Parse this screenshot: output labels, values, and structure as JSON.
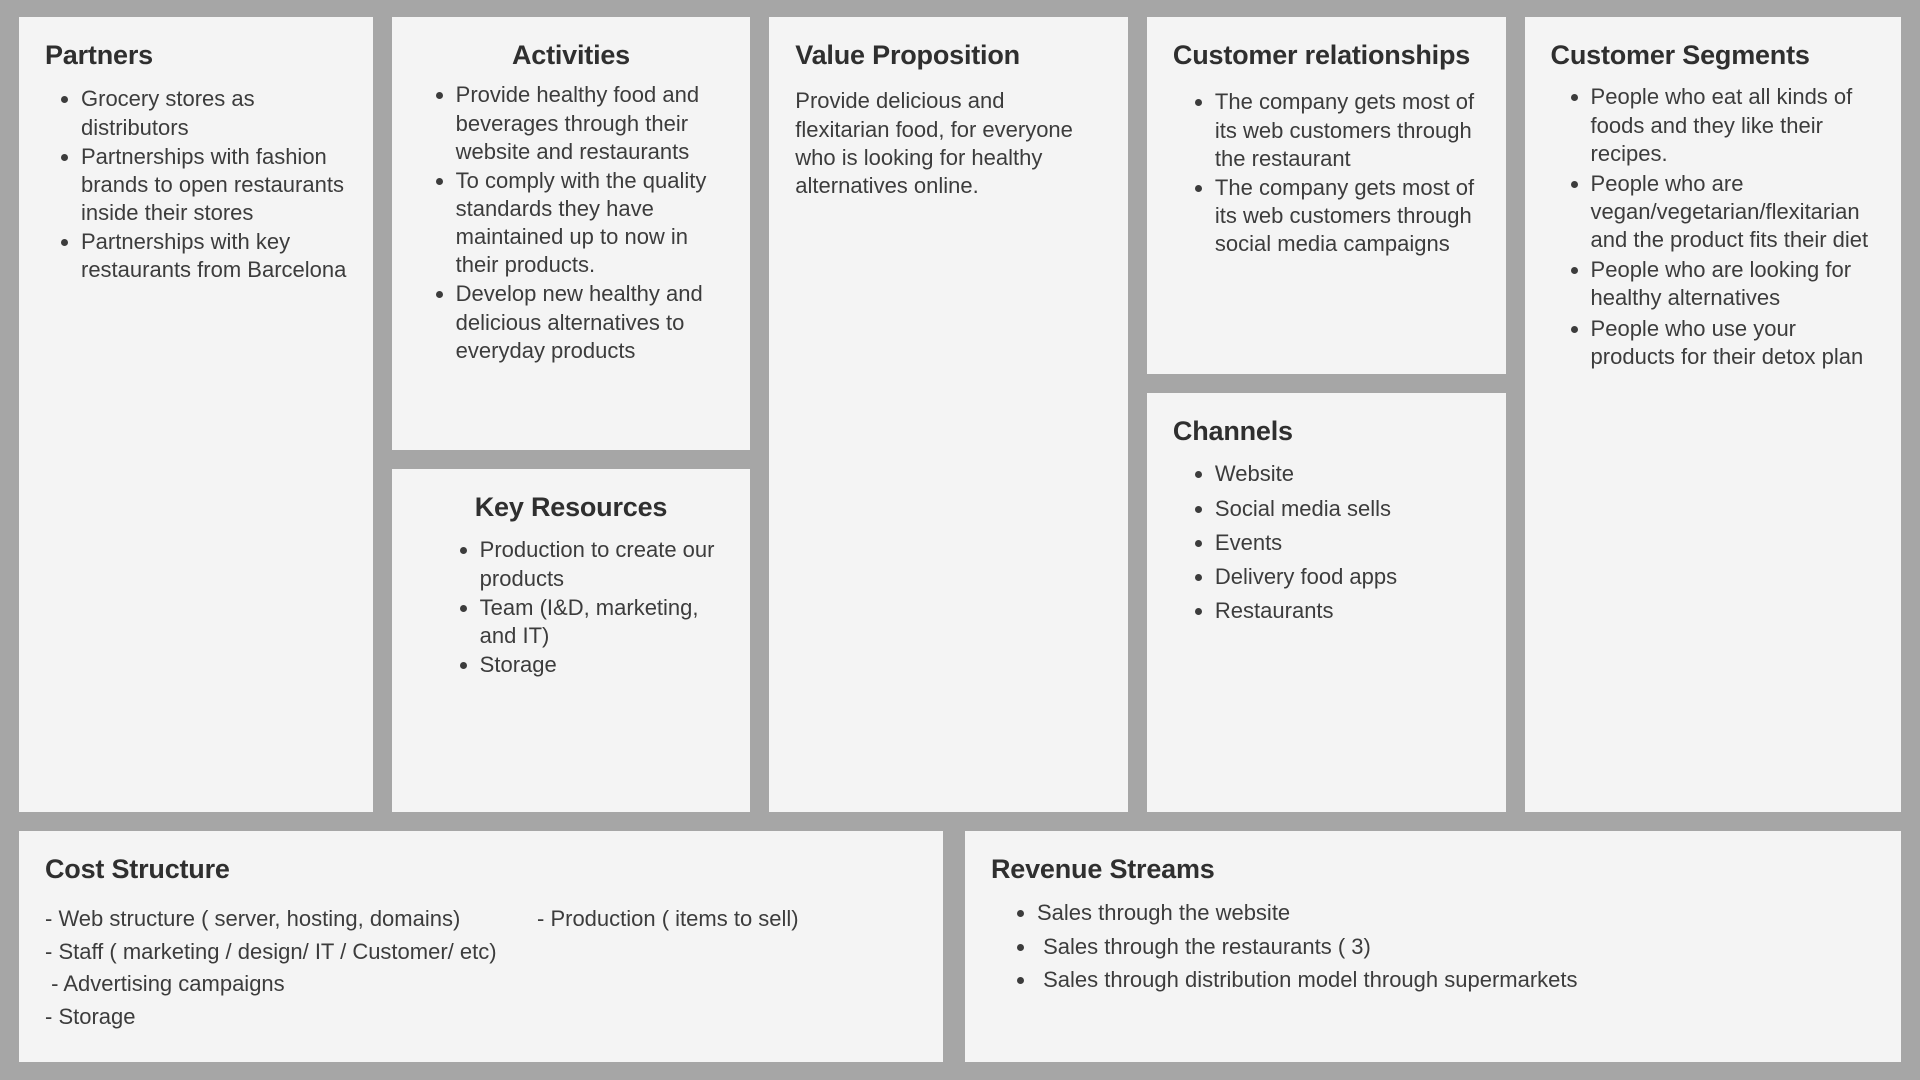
{
  "background_color": "#a6a6a6",
  "panel_color": "#f4f4f4",
  "text_color": "#3c3c3c",
  "heading_color": "#2f2f2f",
  "blocks": {
    "partners": {
      "title": "Partners",
      "items": [
        "Grocery stores as distributors",
        "Partnerships with fashion brands to open restaurants inside their stores",
        "Partnerships with key restaurants from Barcelona"
      ]
    },
    "activities": {
      "title": "Activities",
      "items": [
        "Provide healthy food and beverages through their website and restaurants",
        "To comply with the quality standards they have maintained up to now in their products.",
        "Develop new healthy and delicious alternatives to everyday products"
      ]
    },
    "key_resources": {
      "title": "Key Resources",
      "items": [
        "Production to create our products",
        "Team (I&D, marketing, and IT)",
        "Storage"
      ]
    },
    "value_proposition": {
      "title": "Value Proposition",
      "text": "Provide delicious and flexitarian food, for everyone who is looking for healthy alternatives online."
    },
    "customer_relationships": {
      "title": "Customer relationships",
      "items": [
        "The company gets most of its web customers through the restaurant",
        "The company gets most of  its web customers through social media campaigns"
      ]
    },
    "channels": {
      "title": "Channels",
      "items": [
        "Website",
        "Social media sells",
        "Events",
        "Delivery food apps",
        "Restaurants"
      ]
    },
    "customer_segments": {
      "title": "Customer Segments",
      "items": [
        "People who eat all kinds of foods and they like their recipes.",
        "People who are vegan/vegetarian/flexitarian and the product fits their diet",
        "People who are looking for healthy alternatives",
        "People who use your products for their detox plan"
      ]
    },
    "cost_structure": {
      "title": "Cost Structure",
      "left_lines": [
        "- Web structure ( server, hosting, domains)",
        "- Staff ( marketing / design/ IT / Customer/ etc)",
        " - Advertising campaigns",
        "- Storage"
      ],
      "right_lines": [
        "- Production ( items to sell)"
      ]
    },
    "revenue_streams": {
      "title": "Revenue Streams",
      "items": [
        "Sales through the website",
        " Sales through the restaurants ( 3)",
        " Sales through distribution model through supermarkets"
      ]
    }
  }
}
